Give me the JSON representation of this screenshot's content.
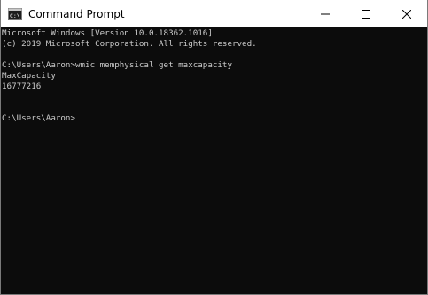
{
  "window": {
    "title": "Command Prompt",
    "icon": "cmd-icon",
    "controls": {
      "minimize_icon": "minimize-icon",
      "maximize_icon": "maximize-icon",
      "close_icon": "close-icon"
    }
  },
  "console": {
    "background": "#0c0c0c",
    "foreground": "#cccccc",
    "lines": [
      "Microsoft Windows [Version 10.0.18362.1016]",
      "(c) 2019 Microsoft Corporation. All rights reserved.",
      "",
      "C:\\Users\\Aaron>wmic memphysical get maxcapacity",
      "MaxCapacity",
      "16777216",
      "",
      "",
      "C:\\Users\\Aaron>"
    ]
  }
}
